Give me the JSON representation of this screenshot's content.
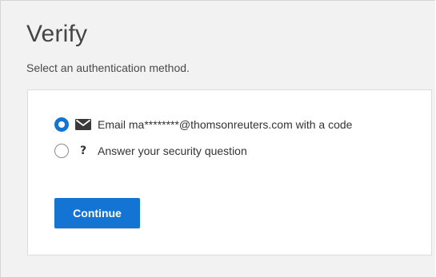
{
  "header": {
    "title": "Verify",
    "subtitle": "Select an authentication method."
  },
  "options": [
    {
      "label": "Email ma********@thomsonreuters.com with a code",
      "icon": "envelope-icon",
      "selected": true
    },
    {
      "label": "Answer your security question",
      "icon": "question-mark-icon",
      "glyph": "?",
      "selected": false
    }
  ],
  "actions": {
    "continue_label": "Continue"
  },
  "colors": {
    "accent": "#1474d4",
    "background": "#f2f2f2",
    "card": "#ffffff"
  }
}
